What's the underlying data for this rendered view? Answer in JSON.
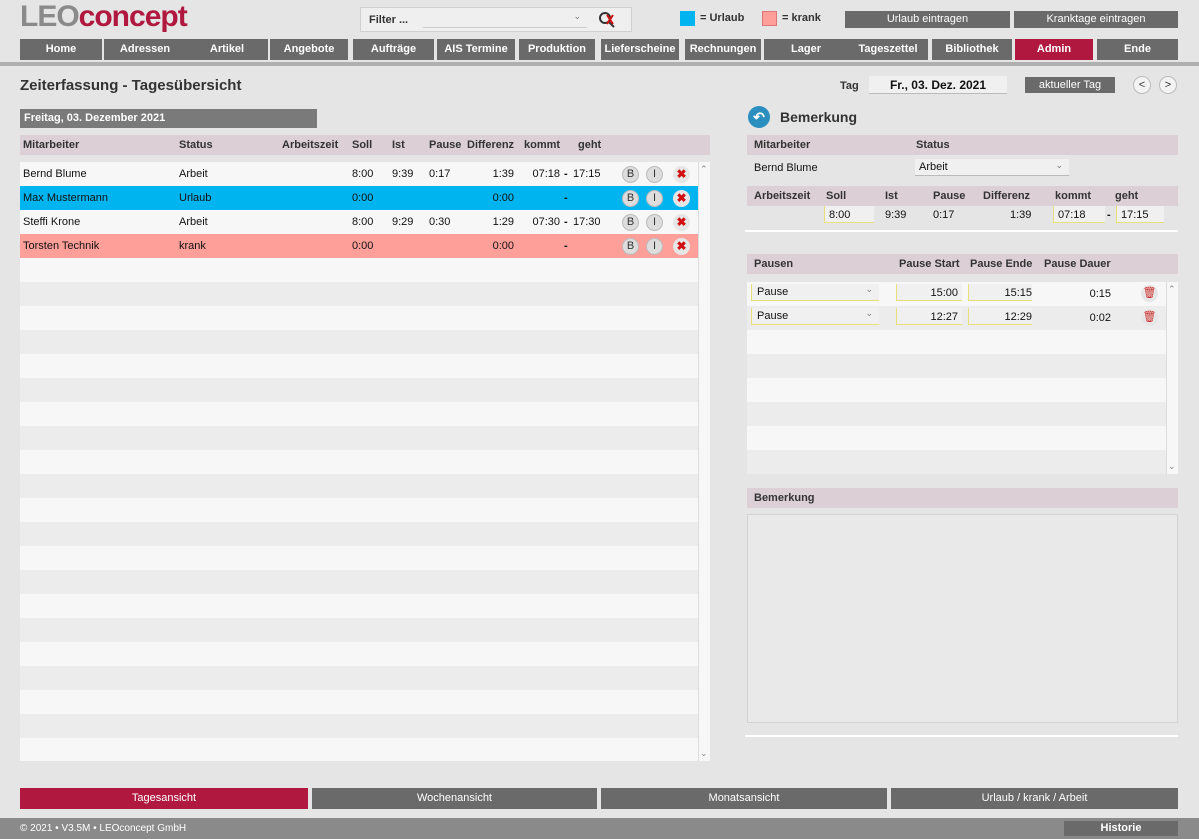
{
  "logo": {
    "part1": "LEO",
    "part2": "concept"
  },
  "filter": {
    "label": "Filter ..."
  },
  "legend": {
    "urlaub": "= Urlaub",
    "krank": "= krank",
    "urlaub_color": "#00b4f0",
    "krank_color": "#ff9f9a"
  },
  "top_buttons": {
    "urlaub": "Urlaub eintragen",
    "krank": "Kranktage eintragen"
  },
  "nav": [
    "Home",
    "Adressen",
    "Artikel",
    "Angebote",
    "Aufträge",
    "AIS Termine",
    "Produktion",
    "Lieferscheine",
    "Rechnungen",
    "Lager",
    "Tageszettel",
    "Bibliothek",
    "Admin",
    "Ende"
  ],
  "nav_active": "Admin",
  "page_title": "Zeiterfassung - Tagesübersicht",
  "tag": {
    "label": "Tag",
    "value": "Fr., 03. Dez. 2021",
    "current_btn": "aktueller Tag",
    "prev": "<",
    "next": ">"
  },
  "day_header": "Freitag, 03. Dezember 2021",
  "columns": {
    "mitarbeiter": "Mitarbeiter",
    "status": "Status",
    "arbeitszeit": "Arbeitszeit",
    "soll": "Soll",
    "ist": "Ist",
    "pause": "Pause",
    "differenz": "Differenz",
    "kommt": "kommt",
    "geht": "geht"
  },
  "rows": [
    {
      "name": "Bernd Blume",
      "status": "Arbeit",
      "soll": "8:00",
      "ist": "9:39",
      "pause": "0:17",
      "diff": "1:39",
      "kommt": "07:18",
      "dash": "-",
      "geht": "17:15",
      "b": "B",
      "i": "I"
    },
    {
      "name": "Max Mustermann",
      "status": "Urlaub",
      "soll": "0:00",
      "ist": "",
      "pause": "",
      "diff": "0:00",
      "kommt": "",
      "dash": "-",
      "geht": "",
      "b": "B",
      "i": "I"
    },
    {
      "name": "Steffi Krone",
      "status": "Arbeit",
      "soll": "8:00",
      "ist": "9:29",
      "pause": "0:30",
      "diff": "1:29",
      "kommt": "07:30",
      "dash": "-",
      "geht": "17:30",
      "b": "B",
      "i": "I"
    },
    {
      "name": "Torsten Technik",
      "status": "krank",
      "soll": "0:00",
      "ist": "",
      "pause": "",
      "diff": "0:00",
      "kommt": "",
      "dash": "-",
      "geht": "",
      "b": "B",
      "i": "I"
    }
  ],
  "detail": {
    "title": "Bemerkung",
    "mitarbeiter_lbl": "Mitarbeiter",
    "status_lbl": "Status",
    "mitarbeiter": "Bernd Blume",
    "status": "Arbeit",
    "arbeitszeit_lbl": "Arbeitszeit",
    "soll_lbl": "Soll",
    "ist_lbl": "Ist",
    "pause_lbl": "Pause",
    "differenz_lbl": "Differenz",
    "kommt_lbl": "kommt",
    "geht_lbl": "geht",
    "soll": "8:00",
    "ist": "9:39",
    "pause": "0:17",
    "differenz": "1:39",
    "kommt": "07:18",
    "dash": "-",
    "geht": "17:15"
  },
  "pausen": {
    "hdr": {
      "name": "Pausen",
      "start": "Pause Start",
      "ende": "Pause Ende",
      "dauer": "Pause Dauer"
    },
    "items": [
      {
        "type": "Pause",
        "start": "15:00",
        "ende": "15:15",
        "dauer": "0:15"
      },
      {
        "type": "Pause",
        "start": "12:27",
        "ende": "12:29",
        "dauer": "0:02"
      }
    ]
  },
  "bemerkung_hdr": "Bemerkung",
  "bottom_tabs": [
    "Tagesansicht",
    "Wochenansicht",
    "Monatsansicht",
    "Urlaub / krank / Arbeit"
  ],
  "footer": {
    "text": "© 2021 • V3.5M • LEOconcept GmbH",
    "historie": "Historie"
  }
}
